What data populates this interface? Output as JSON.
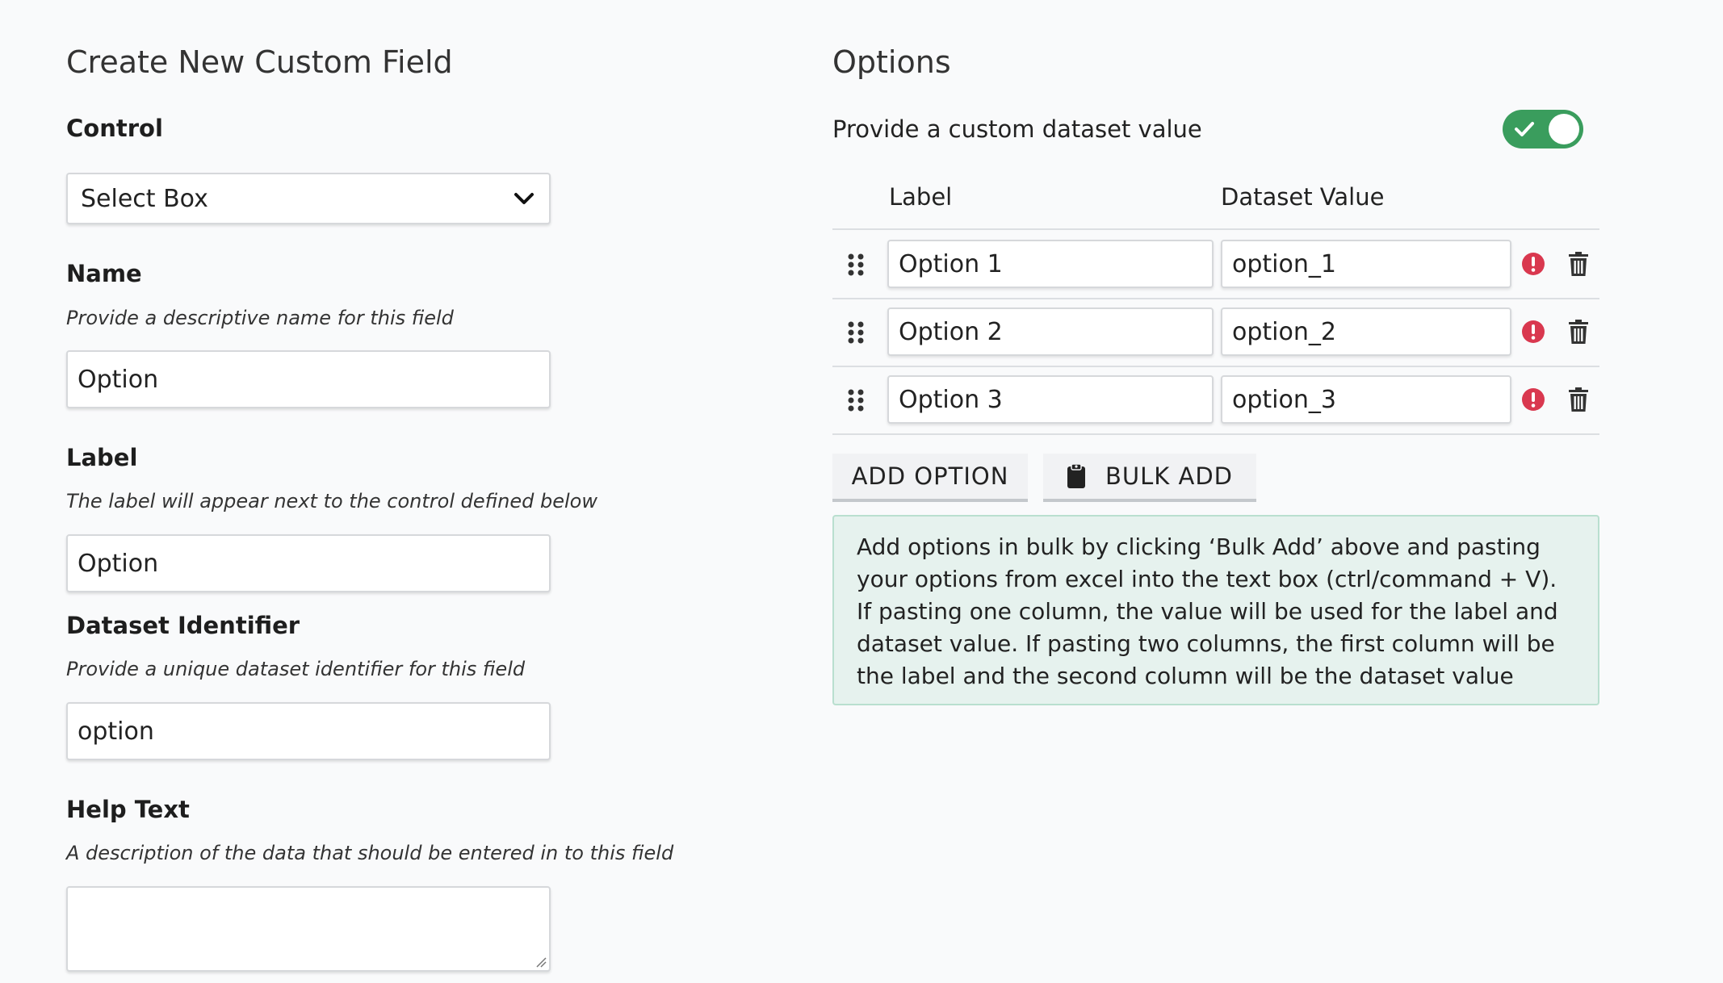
{
  "left": {
    "title": "Create New Custom Field",
    "control": {
      "label": "Control",
      "value": "Select Box"
    },
    "name": {
      "label": "Name",
      "help": "Provide a descriptive name for this field",
      "value": "Option"
    },
    "label_field": {
      "label": "Label",
      "help": "The label will appear next to the control defined below",
      "value": "Option"
    },
    "dataset_identifier": {
      "label": "Dataset Identifier",
      "help": "Provide a unique dataset identifier for this field",
      "value": "option"
    },
    "help_text": {
      "label": "Help Text",
      "help": "A description of the data that should be entered in to this field",
      "value": ""
    }
  },
  "right": {
    "title": "Options",
    "custom_dataset_toggle": {
      "label": "Provide a custom dataset value",
      "on": true
    },
    "columns": {
      "label": "Label",
      "dataset_value": "Dataset Value"
    },
    "options": [
      {
        "label": "Option 1",
        "value": "option_1"
      },
      {
        "label": "Option 2",
        "value": "option_2"
      },
      {
        "label": "Option 3",
        "value": "option_3"
      }
    ],
    "buttons": {
      "add_option": "ADD OPTION",
      "bulk_add": "BULK ADD"
    },
    "info_text": "Add options in bulk by clicking ‘Bulk Add’ above and pasting your options from excel into the text box (ctrl/command + V). If pasting one column, the value will be used for the label and dataset value. If pasting two columns, the first column will be the label and the second column will be the dataset value"
  },
  "colors": {
    "toggle_on": "#3a9d5d",
    "alert": "#d9384f",
    "info_bg": "#e6f2ee",
    "info_border": "#b9dfcf"
  },
  "icons": {
    "select": "chevron-down-icon",
    "drag": "drag-handle-icon",
    "alert": "exclamation-circle-icon",
    "delete": "trash-icon",
    "bulk": "clipboard-icon",
    "toggle": "check-icon"
  }
}
